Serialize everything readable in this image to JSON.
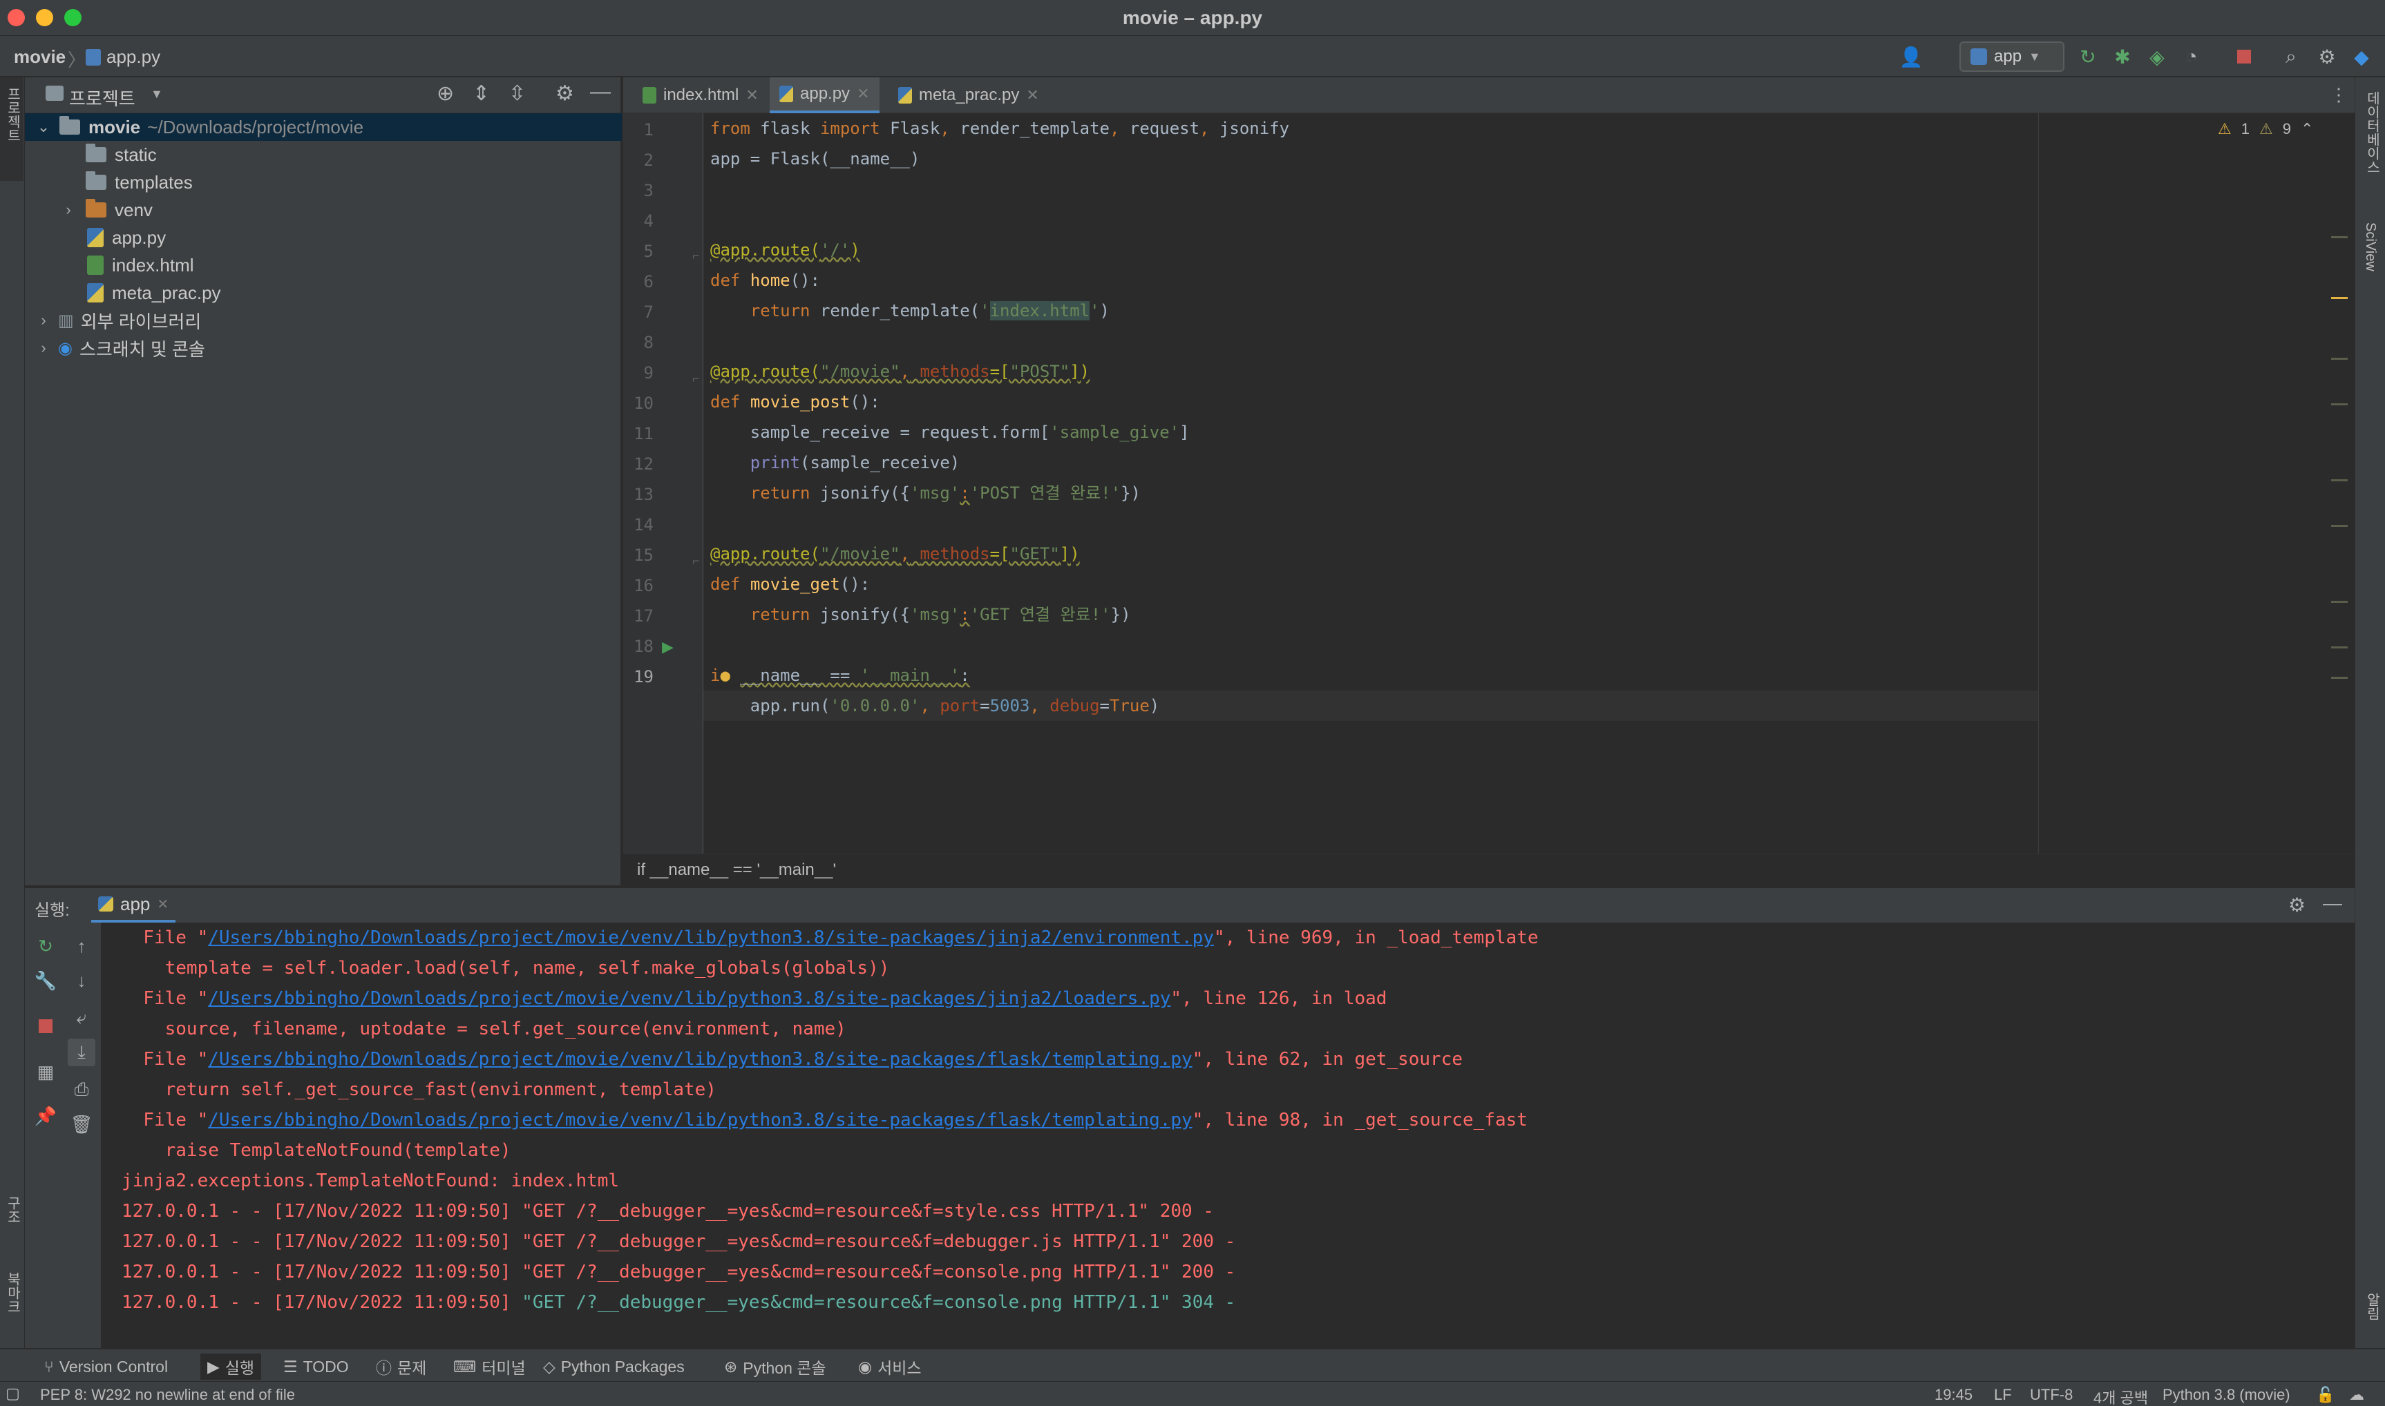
{
  "window": {
    "title": "movie – app.py"
  },
  "navbar": {
    "breadcrumb": [
      "movie",
      "app.py"
    ],
    "run_config": "app"
  },
  "left_strip": {
    "top_label": "프로젝트",
    "structure_label": "구조",
    "bookmarks_label": "북마크"
  },
  "right_strip": {
    "database_label": "데이터베이스",
    "sciview_label": "SciView",
    "notifications_label": "알림"
  },
  "project": {
    "header_label": "프로젝트",
    "tree": [
      {
        "label": "movie",
        "path": "~/Downloads/project/movie",
        "type": "folder",
        "expanded": true
      },
      {
        "label": "static",
        "type": "folder"
      },
      {
        "label": "templates",
        "type": "folder"
      },
      {
        "label": "venv",
        "type": "folder-orange"
      },
      {
        "label": "app.py",
        "type": "python"
      },
      {
        "label": "index.html",
        "type": "html"
      },
      {
        "label": "meta_prac.py",
        "type": "python"
      },
      {
        "label": "외부 라이브러리",
        "type": "library"
      },
      {
        "label": "스크래치 및 콘솔",
        "type": "scratch"
      }
    ]
  },
  "editor": {
    "tabs": [
      {
        "label": "index.html",
        "active": false
      },
      {
        "label": "app.py",
        "active": true
      },
      {
        "label": "meta_prac.py",
        "active": false
      }
    ],
    "inspections": {
      "warnings": "1",
      "weak_warnings": "9"
    },
    "line_numbers": [
      "1",
      "2",
      "3",
      "4",
      "5",
      "6",
      "7",
      "8",
      "9",
      "10",
      "11",
      "12",
      "13",
      "14",
      "15",
      "16",
      "17",
      "18",
      "19"
    ],
    "breadcrumb": "if __name__ == '__main__'"
  },
  "run_panel": {
    "label": "실행:",
    "tab": "app",
    "console": [
      {
        "pre": "  File \"",
        "link": "/Users/bbingho/Downloads/project/movie/venv/lib/python3.8/site-packages/jinja2/environment.py",
        "post": "\", line 969, in _load_template"
      },
      {
        "pre": "    template = self.loader.load(self, name, self.make_globals(globals))"
      },
      {
        "pre": "  File \"",
        "link": "/Users/bbingho/Downloads/project/movie/venv/lib/python3.8/site-packages/jinja2/loaders.py",
        "post": "\", line 126, in load"
      },
      {
        "pre": "    source, filename, uptodate = self.get_source(environment, name)"
      },
      {
        "pre": "  File \"",
        "link": "/Users/bbingho/Downloads/project/movie/venv/lib/python3.8/site-packages/flask/templating.py",
        "post": "\", line 62, in get_source"
      },
      {
        "pre": "    return self._get_source_fast(environment, template)"
      },
      {
        "pre": "  File \"",
        "link": "/Users/bbingho/Downloads/project/movie/venv/lib/python3.8/site-packages/flask/templating.py",
        "post": "\", line 98, in _get_source_fast"
      },
      {
        "pre": "    raise TemplateNotFound(template)"
      },
      {
        "pre": "jinja2.exceptions.TemplateNotFound: index.html"
      },
      {
        "pre": "127.0.0.1 - - [17/Nov/2022 11:09:50] \"GET /?__debugger__=yes&cmd=resource&f=style.css HTTP/1.1\" 200 -"
      },
      {
        "pre": "127.0.0.1 - - [17/Nov/2022 11:09:50] \"GET /?__debugger__=yes&cmd=resource&f=debugger.js HTTP/1.1\" 200 -"
      },
      {
        "pre": "127.0.0.1 - - [17/Nov/2022 11:09:50] \"GET /?__debugger__=yes&cmd=resource&f=console.png HTTP/1.1\" 200 -"
      },
      {
        "pre": "127.0.0.1 - - [17/Nov/2022 11:09:50] ",
        "green": "\"GET /?__debugger__=yes&cmd=resource&f=console.png HTTP/1.1\" 304 -"
      }
    ]
  },
  "bottom_tabs": [
    "Version Control",
    "실행",
    "TODO",
    "문제",
    "터미널",
    "Python Packages",
    "Python 콘솔",
    "서비스"
  ],
  "status": {
    "message": "PEP 8: W292 no newline at end of file",
    "position": "19:45",
    "line_sep": "LF",
    "encoding": "UTF-8",
    "indent": "4개 공백",
    "interpreter": "Python 3.8 (movie)"
  },
  "colors": {
    "accent": "#4a88c7",
    "error_text": "#ff6b68",
    "link": "#287bde",
    "keyword": "#cc7832",
    "string": "#6a8759"
  }
}
